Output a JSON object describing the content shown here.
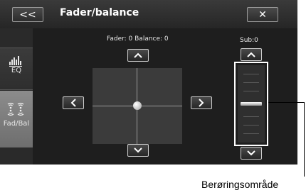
{
  "titlebar": {
    "back_label": "<<",
    "title": "Fader/balance",
    "close_label": "✕"
  },
  "sidebar": {
    "items": [
      {
        "label": "EQ",
        "icon": "eq-icon",
        "active": false
      },
      {
        "label": "Fad/Bal",
        "icon": "speaker-waves-icon",
        "active": true
      }
    ]
  },
  "fader_balance": {
    "status": "Fader: 0 Balance: 0",
    "fader": 0,
    "balance": 0,
    "up_label": "︿",
    "down_label": "﹀",
    "left_label": "<",
    "right_label": ">"
  },
  "subwoofer": {
    "label": "Sub:0",
    "value": 0,
    "up_label": "︿",
    "down_label": "﹀"
  },
  "callout": {
    "text": "Berøringsområde"
  },
  "colors": {
    "accent_active": "#7a7a7a",
    "background": "#1e1e1e",
    "outline": "#ffffff"
  }
}
